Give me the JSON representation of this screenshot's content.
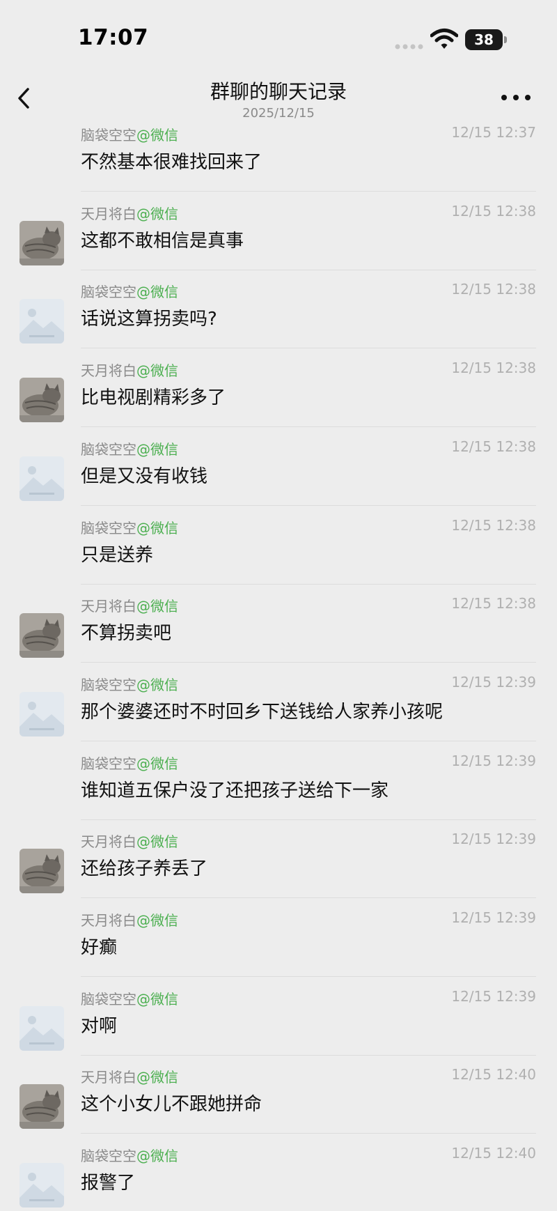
{
  "status_bar": {
    "time": "17:07",
    "battery": "38"
  },
  "nav": {
    "title": "群聊的聊天记录",
    "subtitle": "2025/12/15"
  },
  "messages": [
    {
      "sender": "脑袋空空",
      "app": "@微信",
      "time": "12/15 12:37",
      "text": "不然基本很难找回来了",
      "avatar": "none"
    },
    {
      "sender": "天月将白",
      "app": "@微信",
      "time": "12/15 12:38",
      "text": "这都不敢相信是真事",
      "avatar": "cat-icon"
    },
    {
      "sender": "脑袋空空",
      "app": "@微信",
      "time": "12/15 12:38",
      "text": "话说这算拐卖吗?",
      "avatar": "image-placeholder-icon"
    },
    {
      "sender": "天月将白",
      "app": "@微信",
      "time": "12/15 12:38",
      "text": "比电视剧精彩多了",
      "avatar": "cat-icon"
    },
    {
      "sender": "脑袋空空",
      "app": "@微信",
      "time": "12/15 12:38",
      "text": "但是又没有收钱",
      "avatar": "image-placeholder-icon"
    },
    {
      "sender": "脑袋空空",
      "app": "@微信",
      "time": "12/15 12:38",
      "text": "只是送养",
      "avatar": "none"
    },
    {
      "sender": "天月将白",
      "app": "@微信",
      "time": "12/15 12:38",
      "text": "不算拐卖吧",
      "avatar": "cat-icon"
    },
    {
      "sender": "脑袋空空",
      "app": "@微信",
      "time": "12/15 12:39",
      "text": "那个婆婆还时不时回乡下送钱给人家养小孩呢",
      "avatar": "image-placeholder-icon"
    },
    {
      "sender": "脑袋空空",
      "app": "@微信",
      "time": "12/15 12:39",
      "text": "谁知道五保户没了还把孩子送给下一家",
      "avatar": "none"
    },
    {
      "sender": "天月将白",
      "app": "@微信",
      "time": "12/15 12:39",
      "text": "还给孩子养丢了",
      "avatar": "cat-icon"
    },
    {
      "sender": "天月将白",
      "app": "@微信",
      "time": "12/15 12:39",
      "text": "好癫",
      "avatar": "none"
    },
    {
      "sender": "脑袋空空",
      "app": "@微信",
      "time": "12/15 12:39",
      "text": "对啊",
      "avatar": "image-placeholder-icon"
    },
    {
      "sender": "天月将白",
      "app": "@微信",
      "time": "12/15 12:40",
      "text": "这个小女儿不跟她拼命",
      "avatar": "cat-icon"
    },
    {
      "sender": "脑袋空空",
      "app": "@微信",
      "time": "12/15 12:40",
      "text": "报警了",
      "avatar": "image-placeholder-icon"
    }
  ],
  "colors": {
    "background": "#ededed",
    "app_tag": "#4caf50",
    "muted": "#8a8a8a",
    "timestamp": "#b0b0b0"
  }
}
